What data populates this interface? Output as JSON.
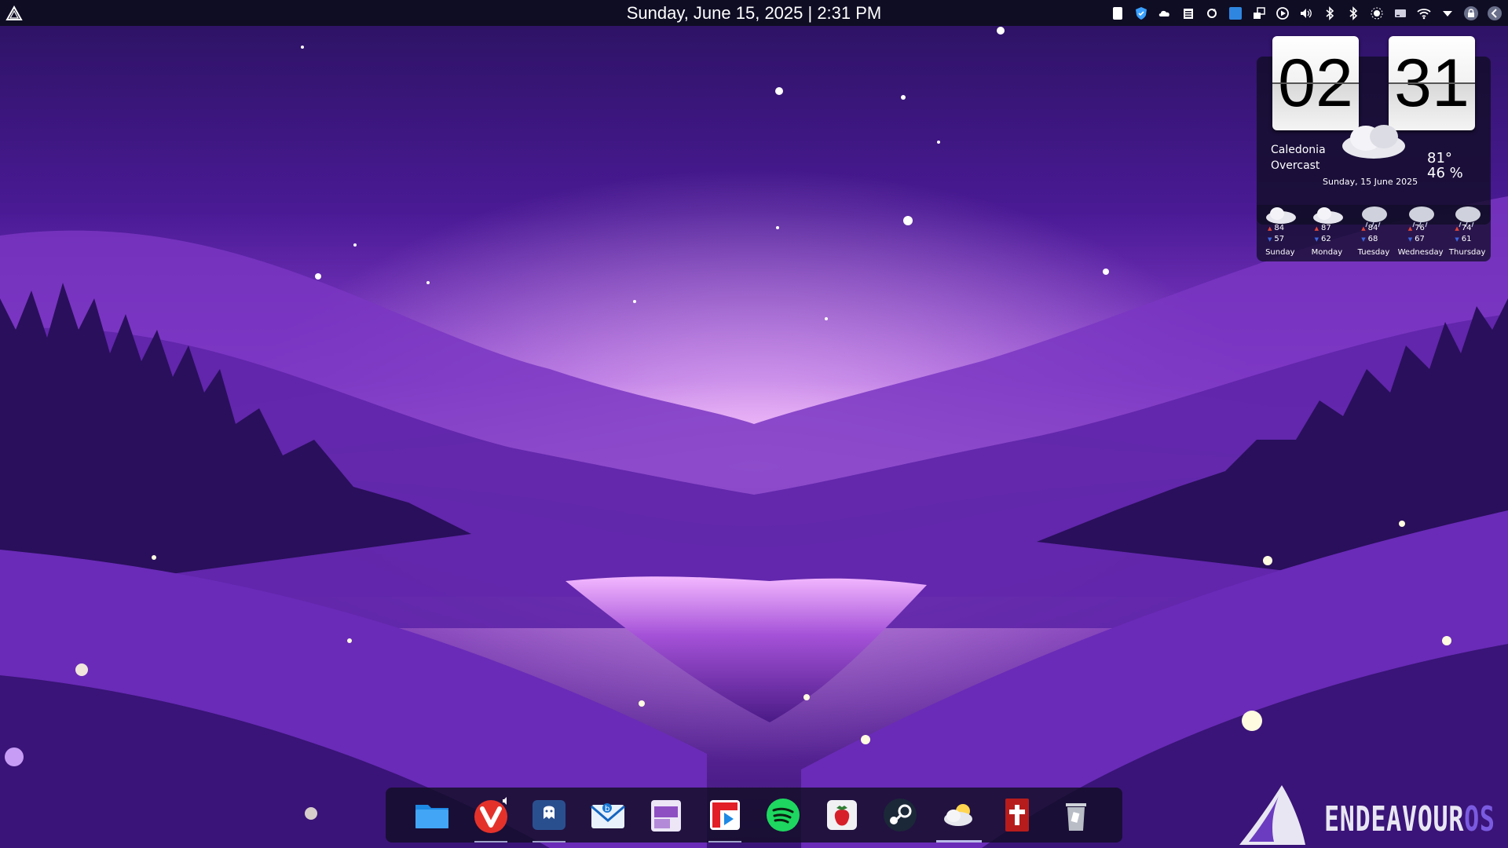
{
  "panel": {
    "clock_text": "Sunday, June 15, 2025 | 2:31 PM",
    "launcher_icon": "endeavouros-launcher-icon",
    "tray_icons": [
      "notes-icon",
      "shield-icon",
      "weather-icon",
      "clipboard-icon",
      "sync-icon",
      "screen-icon",
      "windows-icon",
      "media-player-icon",
      "volume-icon",
      "bluetooth-icon",
      "bluetooth-icon",
      "brightness-icon",
      "drive-icon",
      "wifi-icon",
      "chevron-down-icon",
      "lock-icon",
      "logout-icon"
    ]
  },
  "clock_widget": {
    "hours": "02",
    "minutes": "31",
    "location": "Caledonia",
    "condition": "Overcast",
    "temperature": "81°",
    "humidity": "46 %",
    "date": "Sunday, 15 June 2025",
    "forecast": [
      {
        "day": "Sunday",
        "high": "84",
        "low": "57",
        "icon": "overcast-icon"
      },
      {
        "day": "Monday",
        "high": "87",
        "low": "62",
        "icon": "overcast-icon"
      },
      {
        "day": "Tuesday",
        "high": "84",
        "low": "68",
        "icon": "rain-icon"
      },
      {
        "day": "Wednesday",
        "high": "76",
        "low": "67",
        "icon": "rain-icon"
      },
      {
        "day": "Thursday",
        "high": "74",
        "low": "61",
        "icon": "rain-icon"
      }
    ]
  },
  "dock": {
    "items": [
      "file-manager-icon",
      "vivaldi-browser-icon",
      "ghost-app-icon",
      "bluemail-icon",
      "grape-app-icon",
      "flipboard-player-icon",
      "spotify-icon",
      "strawberry-music-icon",
      "steam-icon",
      "weather-app-icon",
      "bible-app-icon",
      "trash-icon"
    ]
  },
  "brand": {
    "text_main": "ENDEAVOUR",
    "text_accent": "OS"
  },
  "colors": {
    "panel_bg": "#0f0d24",
    "sky_top": "#2a1260",
    "horizon_glow": "#e7a0f5",
    "accent": "#7a5be0"
  }
}
